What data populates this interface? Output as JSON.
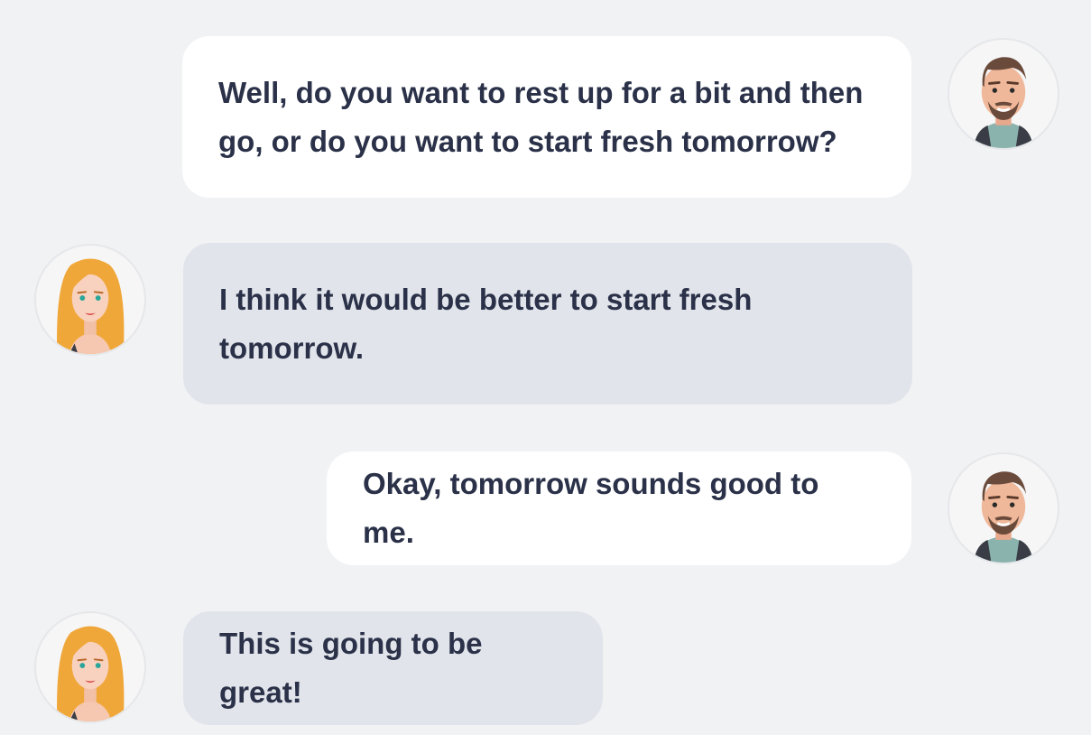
{
  "conversation": {
    "messages": [
      {
        "sender": "male",
        "side": "right",
        "text": "Well, do you want to rest up for a bit and then go, or do you want to start fresh tomorrow?"
      },
      {
        "sender": "female",
        "side": "left",
        "text": "I think it would be better to start fresh tomorrow."
      },
      {
        "sender": "male",
        "side": "right",
        "text": "Okay, tomorrow sounds good to me."
      },
      {
        "sender": "female",
        "side": "left",
        "text": "This is going to be great!"
      }
    ]
  },
  "avatars": {
    "male": "male-avatar-icon",
    "female": "female-avatar-icon"
  },
  "colors": {
    "background": "#f1f2f4",
    "outgoing_bubble": "#ffffff",
    "incoming_bubble": "#e1e4ea",
    "text": "#2a3148"
  }
}
